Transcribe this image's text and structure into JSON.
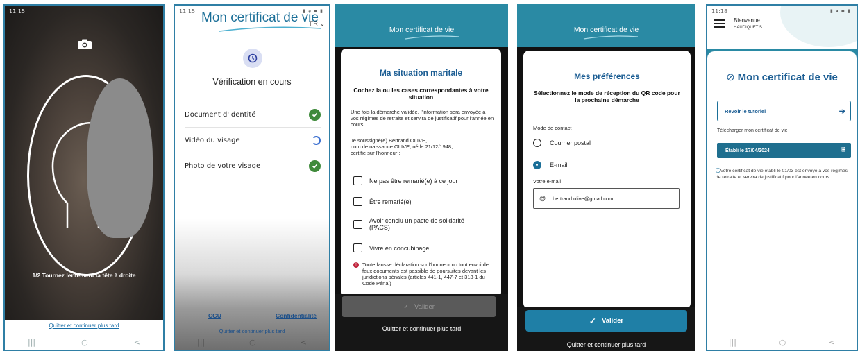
{
  "p1": {
    "status_time": "11:15",
    "instruction": "1/2 Tournez lentement la tête à droite",
    "quit_link": "Quitter et continuer plus tard",
    "nav": [
      "|||",
      "○",
      "<"
    ]
  },
  "p2": {
    "status_time": "11:15",
    "brand": "Mon certificat de vie",
    "lang": "FR",
    "title": "Vérification en cours",
    "items": [
      {
        "label": "Document d'identité",
        "state": "done"
      },
      {
        "label": "Vidéo du visage",
        "state": "loading"
      },
      {
        "label": "Photo de votre visage",
        "state": "done"
      }
    ],
    "cgu": "CGU",
    "confidentialite": "Confidentialité",
    "quit_link": "Quitter et continuer plus tard",
    "nav": [
      "|||",
      "○",
      "<"
    ]
  },
  "p3": {
    "brand": "Mon certificat de vie",
    "title": "Ma situation maritale",
    "subtitle": "Cochez la ou les cases correspondantes à votre situation",
    "info": "Une fois la démarche validée, l'information sera envoyée à vos régimes de retraite et servira de justificatif pour l'année en cours.",
    "declaration_1": "Je soussigné(e) Bertrand OLIVE,",
    "declaration_2": "nom de naissance OLIVE, né le 21/12/1948,",
    "declaration_3": "certifie sur l'honneur :",
    "options": [
      "Ne pas être remarié(e) à ce jour",
      "Être remarié(e)",
      "Avoir conclu un pacte de solidarité (PACS)",
      "Vivre en concubinage"
    ],
    "warning": "Toute fausse déclaration sur l'honneur ou tout envoi de faux documents est passible de poursuites devant les juridictions pénales (articles 441-1, 447-7 et 313-1 du Code Pénal)",
    "validate": "Valider",
    "quit_link": "Quitter et continuer plus tard"
  },
  "p4": {
    "brand": "Mon certificat de vie",
    "title": "Mes préférences",
    "subtitle": "Sélectionnez le mode de réception du QR code pour la prochaine démarche",
    "contact_label": "Mode de contact",
    "option_postal": "Courrier postal",
    "option_email": "E-mail",
    "email_label": "Votre e-mail",
    "email_value": "bertrand.olive@gmail.com",
    "validate": "Valider",
    "quit_link": "Quitter et continuer plus tard"
  },
  "p5": {
    "status_time": "11:18",
    "welcome": "Bienvenue",
    "user": "HAUDIQUET S.",
    "title": "Mon certificat de vie",
    "tutorial": "Revoir le tutoriel",
    "download": "Télécharger mon certificat de vie",
    "established": "Établi le 17/04/2024",
    "note": "Votre certificat de vie établi le 01/03 est envoyé à vos régimes de retraite et servira de justificatif pour l'année en cours.",
    "nav": [
      "|||",
      "○",
      "<"
    ]
  },
  "colors": {
    "primary": "#2a8aa4",
    "title_blue": "#1b5d93",
    "success": "#3f8a3b",
    "danger": "#c0263e"
  }
}
